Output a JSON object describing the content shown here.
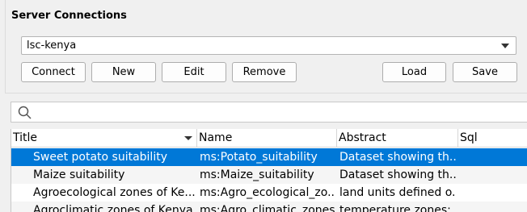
{
  "group": {
    "title": "Server Connections"
  },
  "connection": {
    "selected": "lsc-kenya"
  },
  "buttons": {
    "connect": "Connect",
    "new": "New",
    "edit": "Edit",
    "remove": "Remove",
    "load": "Load",
    "save": "Save"
  },
  "search": {
    "placeholder": "",
    "icon": "search-icon"
  },
  "table": {
    "headers": [
      "Title",
      "Name",
      "Abstract",
      "Sql"
    ],
    "rows": [
      {
        "title": "Sweet potato suitability",
        "name": "ms:Potato_suitability",
        "abstract": "Dataset showing th...",
        "sql": ""
      },
      {
        "title": "Maize suitability",
        "name": "ms:Maize_suitability",
        "abstract": "Dataset showing th...",
        "sql": ""
      },
      {
        "title": "Agroecological zones of Ke...",
        "name": "ms:Agro_ecological_zo...",
        "abstract": "land units defined o...",
        "sql": ""
      },
      {
        "title": "Agroclimatic zones of Kenya",
        "name": "ms:Agro_climatic_zones",
        "abstract": "temperature zones;",
        "sql": ""
      }
    ]
  },
  "colors": {
    "selection": "#0078d7",
    "background": "#f0f0f0"
  }
}
